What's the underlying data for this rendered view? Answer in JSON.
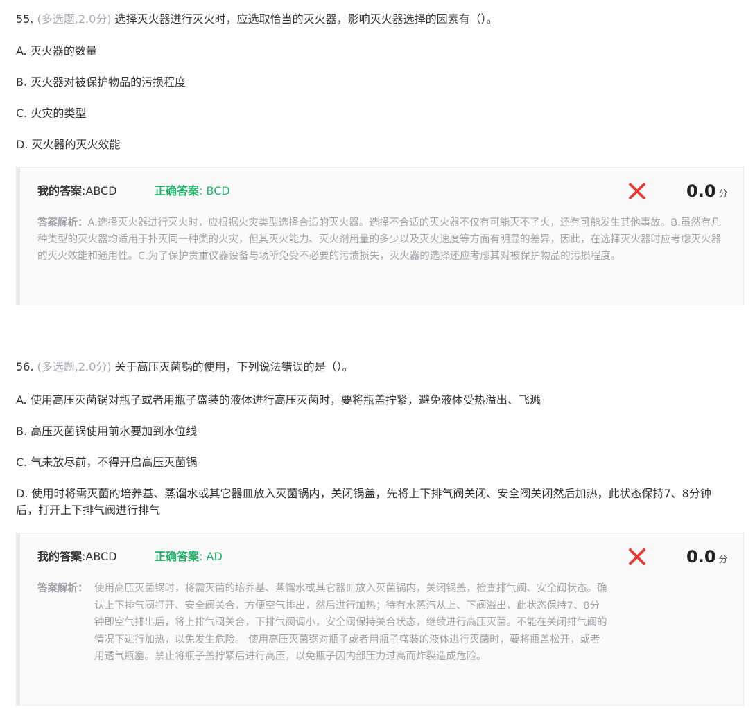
{
  "questions": [
    {
      "number": "55.",
      "meta": "(多选题,2.0分)",
      "stem": "选择灭火器进行灭火时，应选取恰当的灭火器，影响灭火器选择的因素有（）。",
      "options": [
        "A. 灭火器的数量",
        "B. 灭火器对被保护物品的污损程度",
        "C. 火灾的类型",
        "D. 灭火器的灭火效能"
      ],
      "my_answer_label": "我的答案",
      "my_answer_value": ":ABCD",
      "correct_answer_label": "正确答案",
      "correct_answer_value": ": BCD",
      "score": "0.0",
      "score_unit": "分",
      "analysis_label": "答案解析：",
      "analysis_text": "A.选择灭火器进行灭火时，应根据火灾类型选择合适的灭火器。选择不合适的灭火器不仅有可能灭不了火，还有可能发生其他事故。B.虽然有几种类型的灭火器均适用于扑灭同一种类的火灾，但其灭火能力、灭火剂用量的多少以及灭火速度等方面有明显的差异，因此，在选择灭火器时应考虑灭火器的灭火效能和通用性。C.为了保护贵重仪器设备与场所免受不必要的污渍损失，灭火器的选择还应考虑其对被保护物品的污损程度。"
    },
    {
      "number": "56.",
      "meta": "(多选题,2.0分)",
      "stem": "关于高压灭菌锅的使用，下列说法错误的是（）。",
      "options": [
        "A. 使用高压灭菌锅对瓶子或者用瓶子盛装的液体进行高压灭菌时，要将瓶盖拧紧，避免液体受热溢出、飞溅",
        "B. 高压灭菌锅使用前水要加到水位线",
        "C. 气未放尽前，不得开启高压灭菌锅",
        "D. 使用时将需灭菌的培养基、蒸馏水或其它器皿放入灭菌锅内，关闭锅盖，先将上下排气阀关闭、安全阀关闭然后加热，此状态保持7、8分钟后，打开上下排气阀进行排气"
      ],
      "my_answer_label": "我的答案",
      "my_answer_value": ":ABCD",
      "correct_answer_label": "正确答案",
      "correct_answer_value": ": AD",
      "score": "0.0",
      "score_unit": "分",
      "analysis_label": "答案解析：",
      "analysis_text": "使用高压灭菌锅时，将需灭菌的培养基、蒸馏水或其它器皿放入灭菌锅内，关闭锅盖，检查排气阀、安全阀状态。确认上下排气阀打开、安全阀关合，方便空气排出，然后进行加热；待有水蒸汽从上、下阀溢出，此状态保持7、8分钟即空气排出后，将上排气阀关合，下排气阀调小，安全阀保持关合状态，继续进行高压灭菌。不能在关闭排气阀的情况下进行加热，以免发生危险。 使用高压灭菌锅对瓶子或者用瓶子盛装的液体进行灭菌时，要将瓶盖松开，或者用透气瓶塞。禁止将瓶子盖拧紧后进行高压，以免瓶子因内部压力过高而炸裂造成危险。"
    }
  ],
  "colors": {
    "correct": "#21b36b",
    "wrong": "#e53935",
    "meta": "#a8a8b3",
    "analysis": "#a3a3a8"
  },
  "icons": {
    "wrong": "cross-icon"
  }
}
